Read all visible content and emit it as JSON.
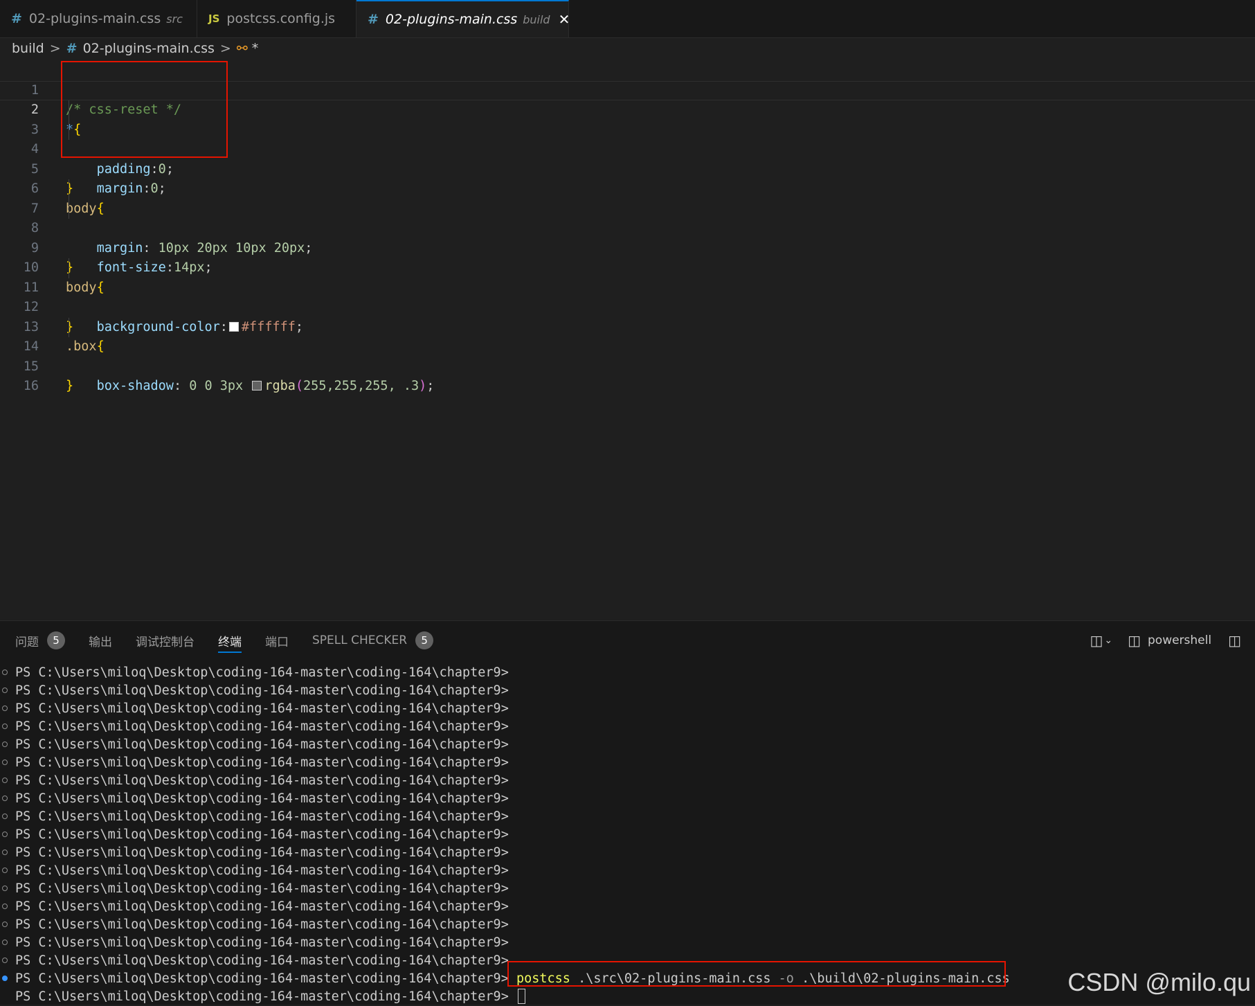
{
  "tabs": [
    {
      "icon": "#",
      "name": "02-plugins-main.css",
      "sub": "src"
    },
    {
      "icon": "JS",
      "name": "postcss.config.js",
      "sub": ""
    },
    {
      "icon": "#",
      "name": "02-plugins-main.css",
      "sub": "build",
      "close": "✕"
    }
  ],
  "breadcrumb": {
    "folder": "build",
    "sep": ">",
    "file_icon": "#",
    "file": "02-plugins-main.css",
    "symbol_icon": "⚯",
    "symbol": "*"
  },
  "editor": {
    "line_numbers": [
      "1",
      "2",
      "3",
      "4",
      "5",
      "6",
      "7",
      "8",
      "9",
      "10",
      "11",
      "12",
      "13",
      "14",
      "15",
      "16"
    ],
    "l1": "/* css-reset */",
    "l2_sel": "*",
    "l2_br": "{",
    "l3_prop": "padding",
    "l3_colon": ":",
    "l3_val": "0",
    "l3_semi": ";",
    "l4_prop": "margin",
    "l4_colon": ":",
    "l4_val": "0",
    "l4_semi": ";",
    "l5": "}",
    "l6_sel": "body",
    "l6_br": "{",
    "l7_prop": "margin",
    "l7_colon": ": ",
    "l7_val": "10px 20px 10px 20px",
    "l7_semi": ";",
    "l8_prop": "font-size",
    "l8_colon": ":",
    "l8_val": "14px",
    "l8_semi": ";",
    "l9": "}",
    "l10_sel": "body",
    "l10_br": "{",
    "l11_prop": "background-color",
    "l11_colon": ":",
    "l11_val": "#ffffff",
    "l11_semi": ";",
    "l12": "}",
    "l13_sel": ".box",
    "l13_br": "{",
    "l14_prop": "box-shadow",
    "l14_colon": ": ",
    "l14_val1": "0 0 3px ",
    "l14_fn": "rgba",
    "l14_open": "(",
    "l14_args": "255,255,255, .3",
    "l14_close": ")",
    "l14_semi": ";",
    "l15": "}"
  },
  "colors": {
    "swatch_white": "#ffffff",
    "swatch_rgba": "rgba(255,255,255,.3)",
    "highlight": "#e51400",
    "accent": "#0078d4"
  },
  "panel": {
    "tabs": [
      {
        "label": "问题",
        "badge": "5"
      },
      {
        "label": "输出"
      },
      {
        "label": "调试控制台"
      },
      {
        "label": "终端"
      },
      {
        "label": "端口"
      },
      {
        "label": "SPELL CHECKER",
        "badge": "5"
      }
    ],
    "active_tab": "终端",
    "shell": "powershell"
  },
  "terminal": {
    "prompt": "PS C:\\Users\\miloq\\Desktop\\coding-164-master\\coding-164\\chapter9>",
    "cmd_name": "postcss",
    "cmd_src": " .\\src\\02-plugins-main.css ",
    "cmd_flag": "-o",
    "cmd_out": " .\\build\\02-plugins-main.css"
  },
  "watermark": "CSDN @milo.qu"
}
